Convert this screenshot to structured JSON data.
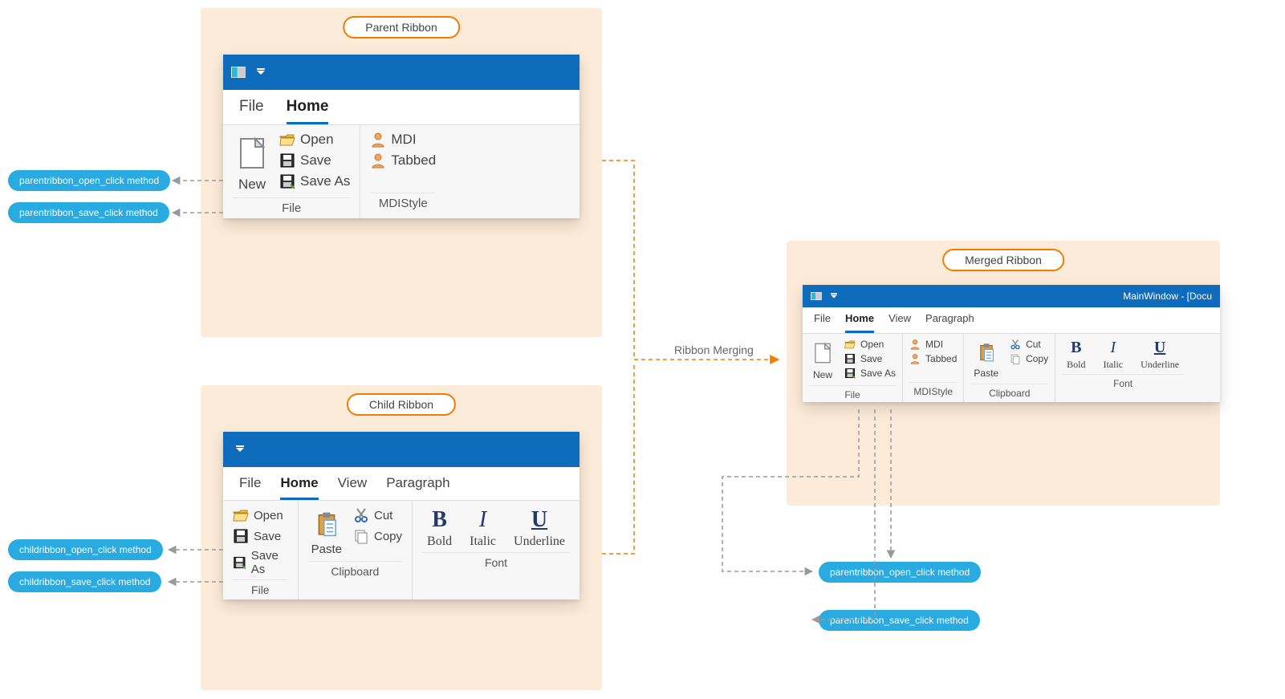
{
  "parent": {
    "panelLabel": "Parent Ribbon",
    "tabs": {
      "file": "File",
      "home": "Home"
    },
    "file": {
      "new": "New",
      "open": "Open",
      "save": "Save",
      "saveAs": "Save As",
      "groupLabel": "File"
    },
    "mdi": {
      "mdi": "MDI",
      "tabbed": "Tabbed",
      "groupLabel": "MDIStyle"
    },
    "methods": {
      "open": "parentribbon_open_click method",
      "save": "parentribbon_save_click method"
    }
  },
  "child": {
    "panelLabel": "Child Ribbon",
    "tabs": {
      "file": "File",
      "home": "Home",
      "view": "View",
      "paragraph": "Paragraph"
    },
    "file": {
      "open": "Open",
      "save": "Save",
      "saveAs": "Save As",
      "groupLabel": "File"
    },
    "clipboard": {
      "paste": "Paste",
      "cut": "Cut",
      "copy": "Copy",
      "groupLabel": "Clipboard"
    },
    "font": {
      "bold": "Bold",
      "italic": "Italic",
      "underline": "Underline",
      "groupLabel": "Font"
    },
    "methods": {
      "open": "childribbon_open_click method",
      "save": "childribbon_save_click method"
    }
  },
  "merged": {
    "panelLabel": "Merged Ribbon",
    "windowTitle": "MainWindow - [Docu",
    "tabs": {
      "file": "File",
      "home": "Home",
      "view": "View",
      "paragraph": "Paragraph"
    },
    "file": {
      "new": "New",
      "open": "Open",
      "save": "Save",
      "saveAs": "Save As",
      "groupLabel": "File"
    },
    "mdi": {
      "mdi": "MDI",
      "tabbed": "Tabbed",
      "groupLabel": "MDIStyle"
    },
    "clipboard": {
      "paste": "Paste",
      "cut": "Cut",
      "copy": "Copy",
      "groupLabel": "Clipboard"
    },
    "font": {
      "bold": "Bold",
      "italic": "Italic",
      "underline": "Underline",
      "groupLabel": "Font"
    },
    "methods": {
      "open": "parentribbon_open_click method",
      "save": "parentribbon_save_click method"
    }
  },
  "mergeLabel": "Ribbon Merging",
  "glyphs": {
    "B": "B",
    "I": "I",
    "U": "U"
  }
}
